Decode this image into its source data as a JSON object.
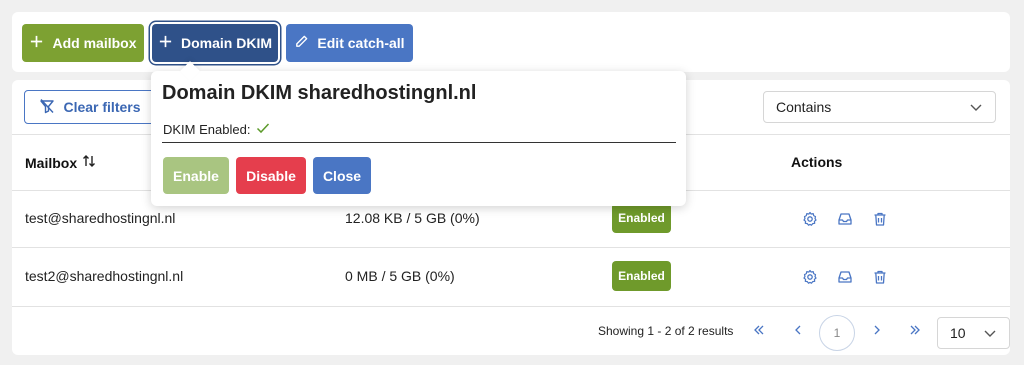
{
  "toolbar": {
    "add_mailbox": "Add mailbox",
    "domain_dkim": "Domain DKIM",
    "edit_catch_all": "Edit catch-all"
  },
  "filters": {
    "clear_filters": "Clear filters",
    "match_mode": "Contains"
  },
  "table": {
    "headers": {
      "mailbox": "Mailbox",
      "actions": "Actions"
    },
    "rows": [
      {
        "mailbox": "test@sharedhostingnl.nl",
        "usage": "12.08 KB / 5 GB (0%)",
        "status": "Enabled"
      },
      {
        "mailbox": "test2@sharedhostingnl.nl",
        "usage": "0 MB / 5 GB (0%)",
        "status": "Enabled"
      }
    ]
  },
  "pagination": {
    "summary": "Showing 1 - 2 of 2 results",
    "current_page": "1",
    "per_page": "10"
  },
  "popover": {
    "title": "Domain DKIM sharedhostingnl.nl",
    "dkim_label": "DKIM Enabled:",
    "enable": "Enable",
    "disable": "Disable",
    "close": "Close"
  },
  "colors": {
    "green": "#7da132",
    "navy": "#2f5189",
    "blue": "#4a76c4",
    "red": "#e53e4d",
    "badge": "#6f9a2b"
  },
  "icons": {
    "add": "plus-icon",
    "edit": "pencil-icon",
    "filter": "filter-off-icon",
    "sort": "sort-icon",
    "settings": "gear-icon",
    "inbox": "inbox-icon",
    "delete": "trash-icon",
    "check": "check-icon"
  }
}
